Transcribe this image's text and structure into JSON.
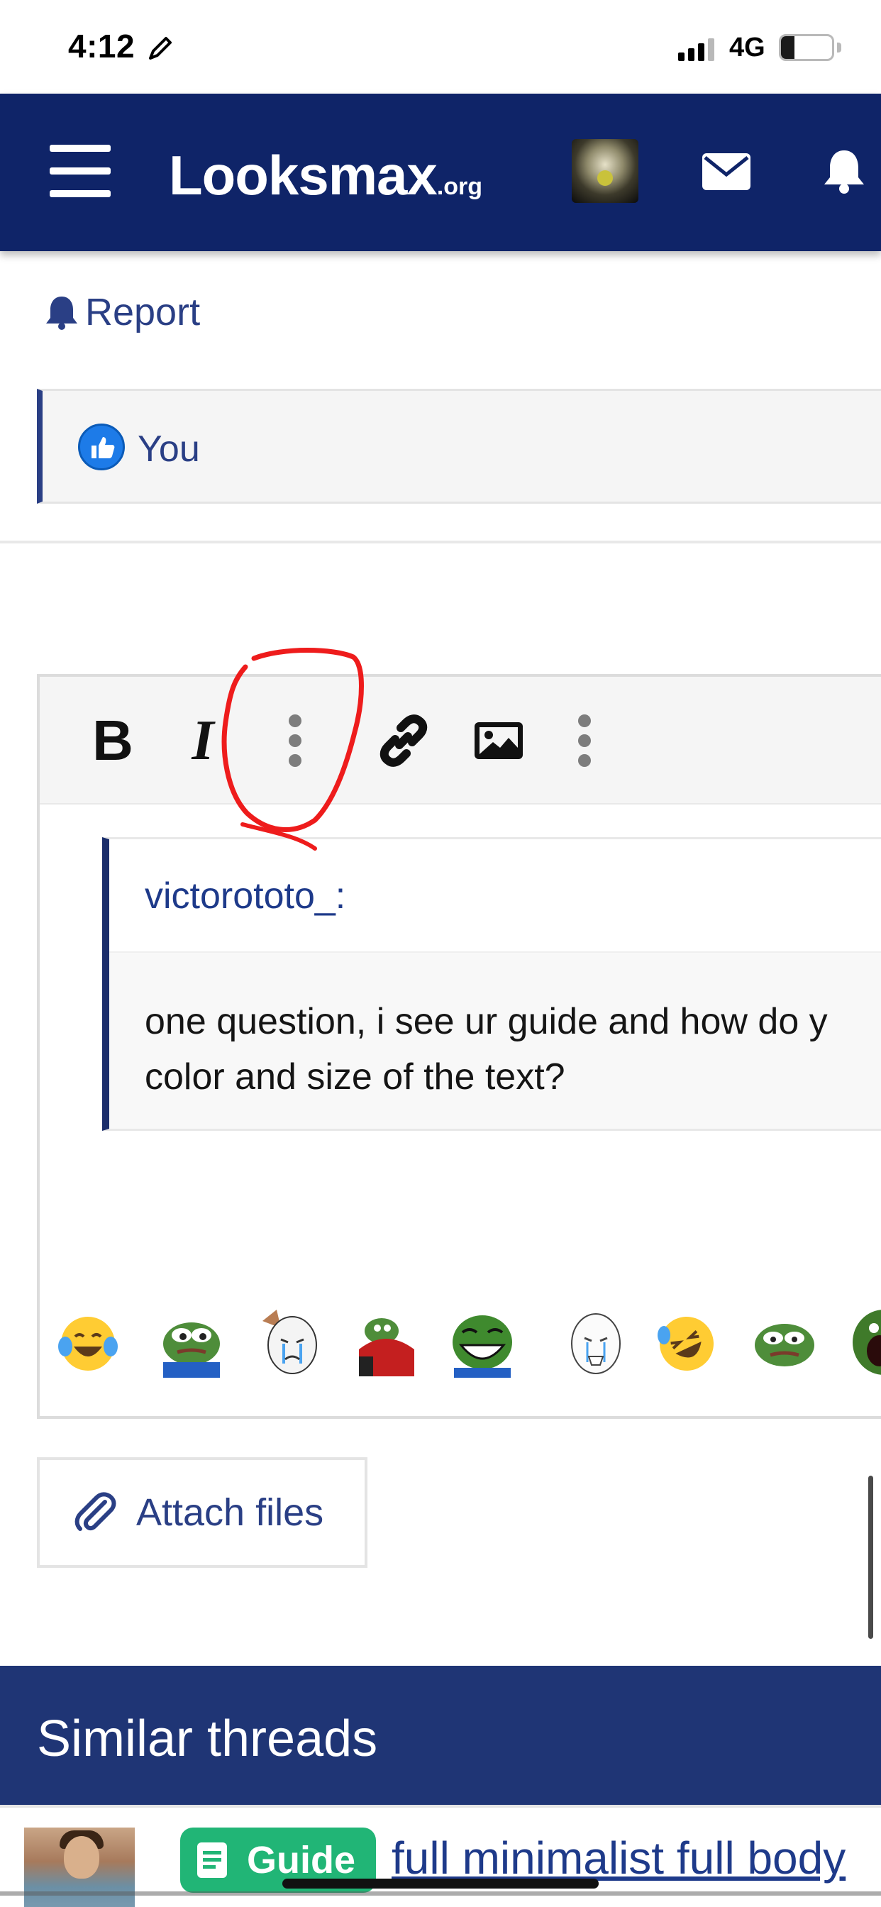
{
  "status_bar": {
    "time": "4:12",
    "network": "4G",
    "battery": "27"
  },
  "navbar": {
    "brand": "Looksmax",
    "brand_suffix": ".org",
    "icons": [
      "menu-icon",
      "avatar",
      "mail-icon",
      "bell-icon"
    ]
  },
  "post": {
    "report_label": "Report",
    "reaction_users": "You"
  },
  "editor": {
    "toolbar": {
      "bold": "B",
      "italic": "I"
    },
    "quote": {
      "author": "victorototo_:",
      "line1": "one question, i see ur guide and how do y",
      "line2": "color and size of the text?"
    },
    "emojis": [
      "joy-emoji",
      "sad-pepe",
      "crying-wojak",
      "pepe-blanket",
      "laughing-pepe",
      "crying-wojak-2",
      "rofl-emoji",
      "sad-pepe-2",
      "screaming-pepe"
    ]
  },
  "attach": {
    "label": "Attach files"
  },
  "similar_threads": {
    "heading": "Similar threads",
    "items": [
      {
        "badge": "Guide",
        "title": "full minimalist full body"
      }
    ]
  },
  "colors": {
    "navbar": "#0f2468",
    "accent": "#2a3f85",
    "section_header": "#1f3575",
    "guide_badge": "#21b576",
    "annotation": "#ee1c1c"
  }
}
